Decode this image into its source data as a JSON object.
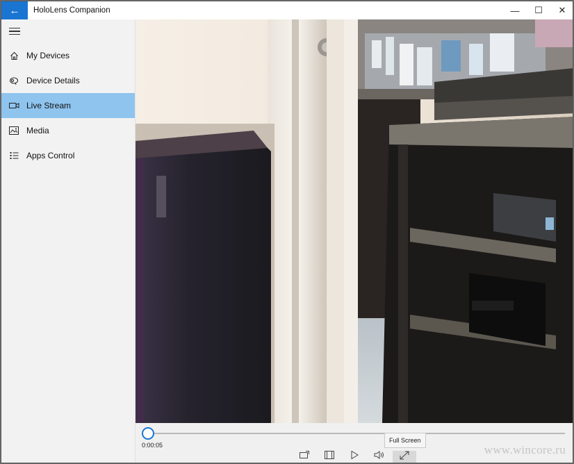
{
  "titlebar": {
    "back_icon": "arrow-left-icon",
    "title": "HoloLens Companion",
    "minimize": "—",
    "maximize": "☐",
    "close": "✕"
  },
  "sidebar": {
    "menu_icon": "hamburger-icon",
    "items": [
      {
        "label": "My Devices",
        "icon": "home-icon",
        "active": false
      },
      {
        "label": "Device Details",
        "icon": "device-icon",
        "active": false
      },
      {
        "label": "Live Stream",
        "icon": "camera-icon",
        "active": true
      },
      {
        "label": "Media",
        "icon": "photo-icon",
        "active": false
      },
      {
        "label": "Apps Control",
        "icon": "list-icon",
        "active": false
      }
    ]
  },
  "player": {
    "time": "0:00:05",
    "progress": 0.0,
    "tooltip": "Full Screen",
    "buttons": [
      "cast-icon",
      "aspect-ratio-icon",
      "play-icon",
      "volume-icon",
      "fullscreen-icon"
    ]
  },
  "colors": {
    "accent": "#1a75d2",
    "active_nav": "#8fc4ee"
  },
  "watermark": "www.wincore.ru"
}
